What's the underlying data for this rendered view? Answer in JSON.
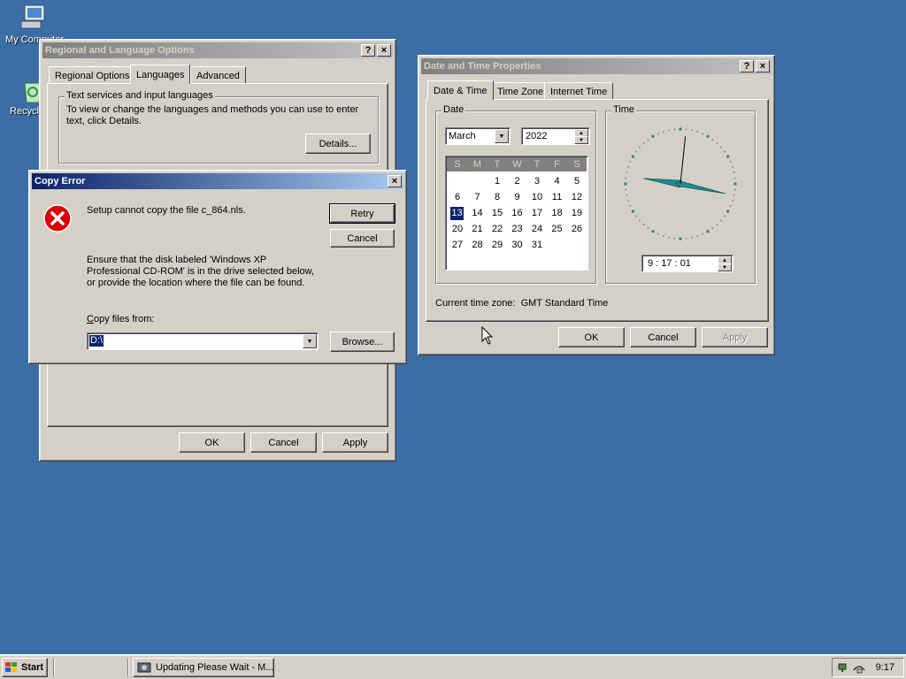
{
  "desktop": {
    "icons": [
      {
        "label": "My Computer"
      },
      {
        "label": "Recycle Bin"
      }
    ]
  },
  "regional": {
    "title": "Regional and Language Options",
    "help_btn": "?",
    "close_btn": "×",
    "tabs": [
      "Regional Options",
      "Languages",
      "Advanced"
    ],
    "selected_tab": "Languages",
    "group_label": "Text services and input languages",
    "group_text": "To view or change the languages and methods you can use to enter text, click Details.",
    "details_label": "Details...",
    "ok_label": "OK",
    "cancel_label": "Cancel",
    "apply_label": "Apply"
  },
  "copy_error": {
    "title": "Copy Error",
    "close_btn": "×",
    "message": "Setup cannot copy the file c_864.nls.",
    "detail": "Ensure that the disk labeled 'Windows XP Professional CD-ROM' is in the drive selected below, or provide the location where the file can be found.",
    "copy_from_label": "Copy files from:",
    "copy_from_value": "D:\\",
    "retry_label": "Retry",
    "cancel_label": "Cancel",
    "browse_label": "Browse..."
  },
  "datetime": {
    "title": "Date and Time Properties",
    "help_btn": "?",
    "close_btn": "×",
    "tabs": [
      "Date & Time",
      "Time Zone",
      "Internet Time"
    ],
    "date_group": "Date",
    "time_group": "Time",
    "month": "March",
    "year": "2022",
    "weekdays": [
      "S",
      "M",
      "T",
      "W",
      "T",
      "F",
      "S"
    ],
    "calendar_rows": [
      [
        "",
        "",
        "1",
        "2",
        "3",
        "4",
        "5"
      ],
      [
        "6",
        "7",
        "8",
        "9",
        "10",
        "11",
        "12"
      ],
      [
        "13",
        "14",
        "15",
        "16",
        "17",
        "18",
        "19"
      ],
      [
        "20",
        "21",
        "22",
        "23",
        "24",
        "25",
        "26"
      ],
      [
        "27",
        "28",
        "29",
        "30",
        "31",
        "",
        ""
      ]
    ],
    "selected_day": "13",
    "time_value": "9 : 17 : 01",
    "clock": {
      "hour": 9,
      "minute": 17,
      "second": 1
    },
    "timezone_text": "Current time zone:  GMT Standard Time",
    "ok_label": "OK",
    "cancel_label": "Cancel",
    "apply_label": "Apply"
  },
  "taskbar": {
    "start_label": "Start",
    "task_label": "Updating Please Wait - M...",
    "clock": "9:17"
  },
  "colors": {
    "desktop": "#3a6ea5",
    "title_active": "#0a246a",
    "clock_hand": "#1e8c8c"
  }
}
